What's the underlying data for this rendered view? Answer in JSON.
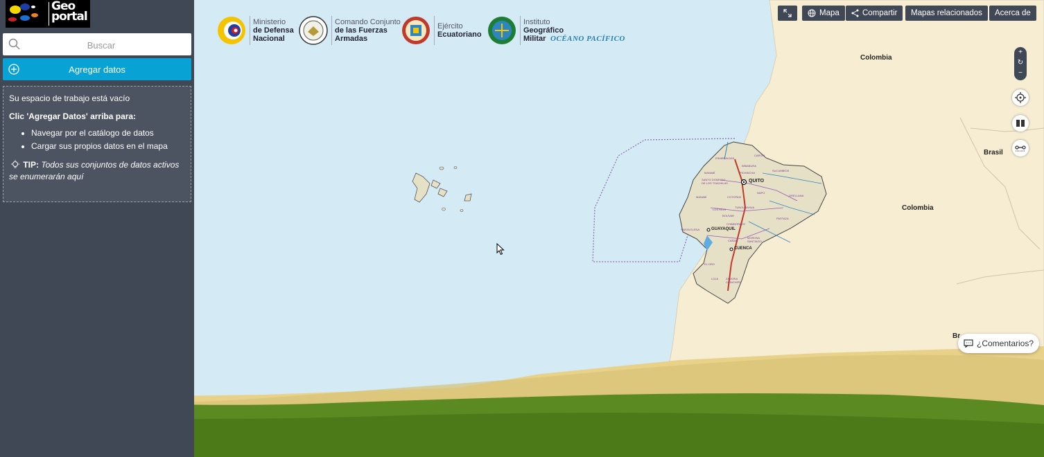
{
  "sidebar": {
    "logo_text": "Geo portal",
    "search_placeholder": "Buscar",
    "add_data_label": "Agregar datos",
    "workspace": {
      "empty_title": "Su espacio de trabajo está vacío",
      "instruction": "Clic 'Agregar Datos' arriba para:",
      "items": [
        "Navegar por el catálogo de datos",
        "Cargar sus propios datos en el mapa"
      ],
      "tip_label": "TIP:",
      "tip_text": "Todos sus conjuntos de datos activos se enumerarán aquí"
    }
  },
  "toolbar": {
    "map_label": "Mapa",
    "share_label": "Compartir",
    "related_label": "Mapas relacionados",
    "about_label": "Acerca de"
  },
  "zoom": {
    "in": "+",
    "reset": "↻",
    "out": "−"
  },
  "logos": [
    {
      "line1": "Ministerio",
      "line2": "de Defensa",
      "line3": "Nacional"
    },
    {
      "line1": "Comando Conjunto",
      "line2": "de las Fuerzas",
      "line3": "Armadas"
    },
    {
      "line1": "Ejército",
      "line2": "Ecuatoriano"
    },
    {
      "line1": "Instituto",
      "line2": "Geográfico",
      "line3": "Militar"
    }
  ],
  "map_labels": {
    "ocean": "OCÉANO PACÍFICO",
    "colombia_top": "Colombia",
    "colombia_mid": "Colombia",
    "brasil": "Brasil",
    "brasil_bottom": "Br",
    "quito": "QUITO",
    "guayaquil": "GUAYAQUIL",
    "cuenca": "CUENCA",
    "provinces": [
      "CARCHI",
      "ESMERALDAS",
      "IMBABURA",
      "SUCUMBÍOS",
      "MANABÍ",
      "PICHINCHA",
      "SANTO DOMINGO DE LOS TSÁCHILAS",
      "NAPO",
      "ORELLANA",
      "COTOPAXI",
      "MANABÍ",
      "LOS RÍOS",
      "TUNGURAHUA",
      "BOLÍVAR",
      "PASTAZA",
      "SANTA ELENA",
      "CHIMBORAZO",
      "MORONA SANTIAGO",
      "CAÑAR",
      "EL ORO",
      "LOJA",
      "ZAMORA CHINCHIPE"
    ]
  },
  "comments_label": "¿Comentarios?",
  "colors": {
    "sidebar": "#3f4854",
    "accent": "#09a2d5",
    "ocean": "#d4ebf6",
    "land": "#f7edd3"
  }
}
